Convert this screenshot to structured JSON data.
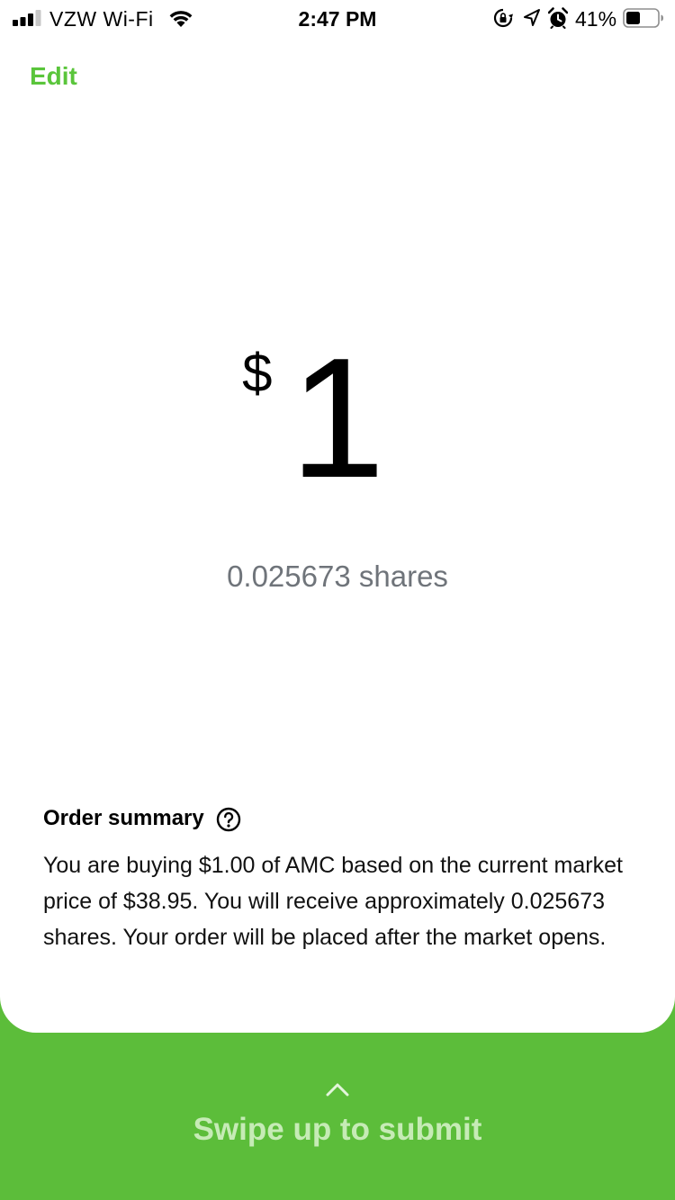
{
  "status_bar": {
    "carrier": "VZW Wi-Fi",
    "time": "2:47 PM",
    "battery_percent": "41%"
  },
  "header": {
    "edit_label": "Edit"
  },
  "order": {
    "currency_symbol": "$",
    "amount": "1",
    "shares_text": "0.025673 shares"
  },
  "summary": {
    "title": "Order summary",
    "text": "You are buying $1.00 of AMC based on the current market price of $38.95. You will receive approximately 0.025673 shares. Your order will be placed after the market opens."
  },
  "submit": {
    "label": "Swipe up to submit"
  },
  "colors": {
    "accent": "#5ac53b",
    "panel": "#5cbd3a",
    "muted_text": "#6f747a",
    "swipe_text": "#c6ebb6"
  },
  "icons": [
    "cellular-signal-icon",
    "wifi-icon",
    "rotation-lock-icon",
    "location-arrow-icon",
    "alarm-clock-icon",
    "battery-icon",
    "help-circle-icon",
    "chevron-up-icon"
  ]
}
